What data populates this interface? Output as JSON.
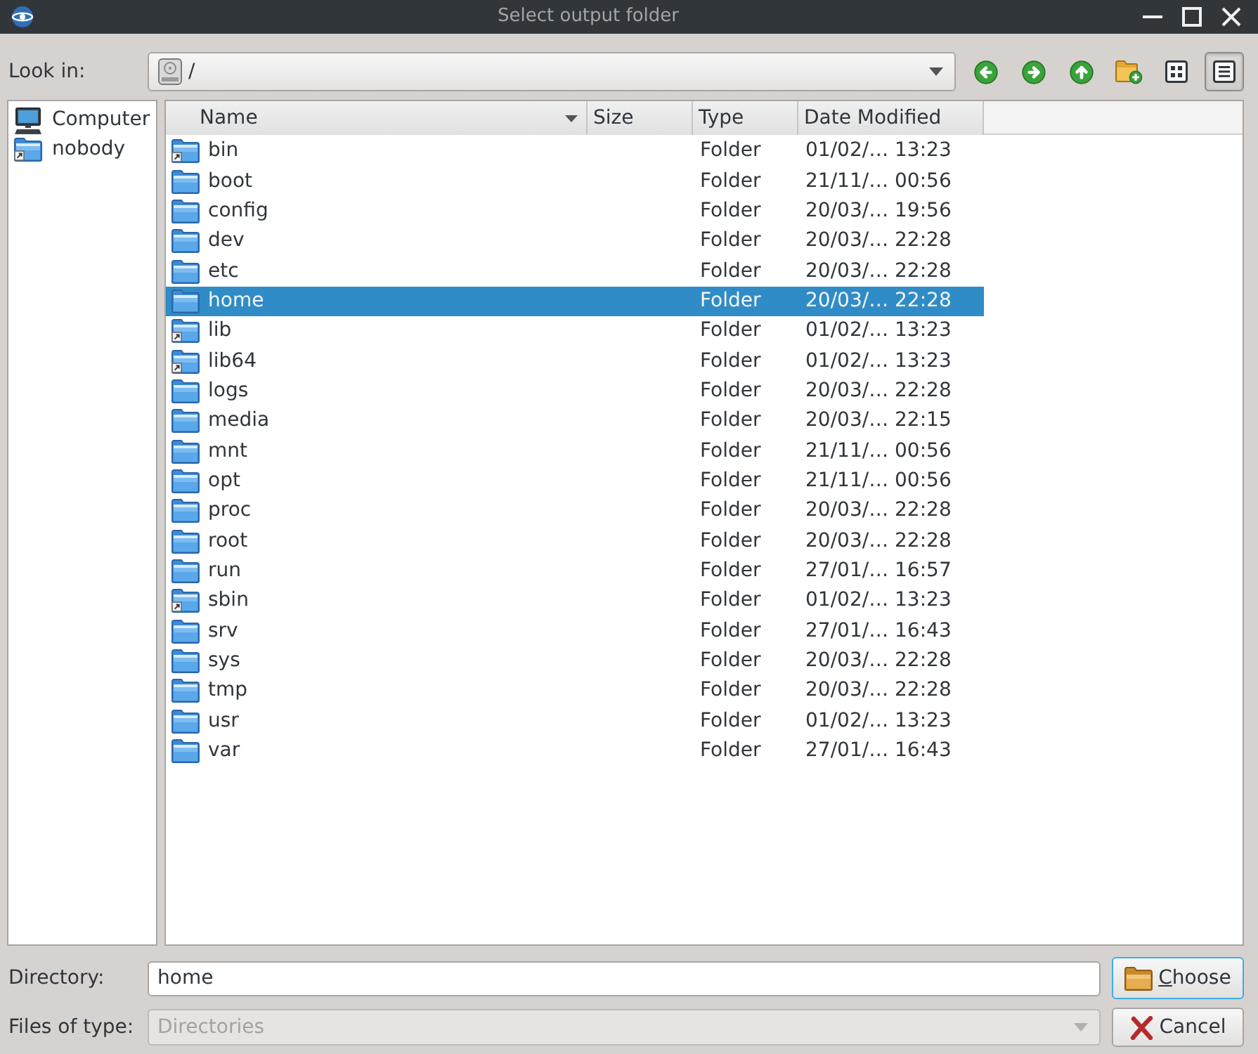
{
  "window": {
    "title": "Select output folder"
  },
  "look_in": {
    "label": "Look in:",
    "value": "/"
  },
  "view_modes": [
    {
      "kind": "list",
      "selected": false
    },
    {
      "kind": "detail",
      "selected": true
    }
  ],
  "sidebar": {
    "items": [
      {
        "label": "Computer",
        "kind": "computer",
        "selected": false
      },
      {
        "label": "nobody",
        "kind": "linked_folder",
        "selected": false
      }
    ]
  },
  "table": {
    "columns": [
      {
        "label": "Name",
        "sorted": true
      },
      {
        "label": "Size",
        "sorted": false
      },
      {
        "label": "Type",
        "sorted": false
      },
      {
        "label": "Date Modified",
        "sorted": false
      }
    ],
    "rows": [
      {
        "name": "bin",
        "link": true,
        "type": "Folder",
        "date_modified": "01/02/… 13:23",
        "selected": false
      },
      {
        "name": "boot",
        "link": false,
        "type": "Folder",
        "date_modified": "21/11/… 00:56",
        "selected": false
      },
      {
        "name": "config",
        "link": false,
        "type": "Folder",
        "date_modified": "20/03/… 19:56",
        "selected": false
      },
      {
        "name": "dev",
        "link": false,
        "type": "Folder",
        "date_modified": "20/03/… 22:28",
        "selected": false
      },
      {
        "name": "etc",
        "link": false,
        "type": "Folder",
        "date_modified": "20/03/… 22:28",
        "selected": false
      },
      {
        "name": "home",
        "link": false,
        "type": "Folder",
        "date_modified": "20/03/… 22:28",
        "selected": true
      },
      {
        "name": "lib",
        "link": true,
        "type": "Folder",
        "date_modified": "01/02/… 13:23",
        "selected": false
      },
      {
        "name": "lib64",
        "link": true,
        "type": "Folder",
        "date_modified": "01/02/… 13:23",
        "selected": false
      },
      {
        "name": "logs",
        "link": false,
        "type": "Folder",
        "date_modified": "20/03/… 22:28",
        "selected": false
      },
      {
        "name": "media",
        "link": false,
        "type": "Folder",
        "date_modified": "20/03/… 22:15",
        "selected": false
      },
      {
        "name": "mnt",
        "link": false,
        "type": "Folder",
        "date_modified": "21/11/… 00:56",
        "selected": false
      },
      {
        "name": "opt",
        "link": false,
        "type": "Folder",
        "date_modified": "21/11/… 00:56",
        "selected": false
      },
      {
        "name": "proc",
        "link": false,
        "type": "Folder",
        "date_modified": "20/03/… 22:28",
        "selected": false
      },
      {
        "name": "root",
        "link": false,
        "type": "Folder",
        "date_modified": "20/03/… 22:28",
        "selected": false
      },
      {
        "name": "run",
        "link": false,
        "type": "Folder",
        "date_modified": "27/01/… 16:57",
        "selected": false
      },
      {
        "name": "sbin",
        "link": true,
        "type": "Folder",
        "date_modified": "01/02/… 13:23",
        "selected": false
      },
      {
        "name": "srv",
        "link": false,
        "type": "Folder",
        "date_modified": "27/01/… 16:43",
        "selected": false
      },
      {
        "name": "sys",
        "link": false,
        "type": "Folder",
        "date_modified": "20/03/… 22:28",
        "selected": false
      },
      {
        "name": "tmp",
        "link": false,
        "type": "Folder",
        "date_modified": "20/03/… 22:28",
        "selected": false
      },
      {
        "name": "usr",
        "link": false,
        "type": "Folder",
        "date_modified": "01/02/… 13:23",
        "selected": false
      },
      {
        "name": "var",
        "link": false,
        "type": "Folder",
        "date_modified": "27/01/… 16:43",
        "selected": false
      }
    ]
  },
  "directory": {
    "label": "Directory:",
    "value": "home"
  },
  "file_type": {
    "label": "Files of type:",
    "value": "Directories",
    "disabled": true
  },
  "buttons": [
    {
      "kind": "choose",
      "label": "Choose",
      "default": true,
      "mnemonic": true
    },
    {
      "kind": "cancel",
      "label": "Cancel",
      "default": false,
      "mnemonic": false
    }
  ]
}
